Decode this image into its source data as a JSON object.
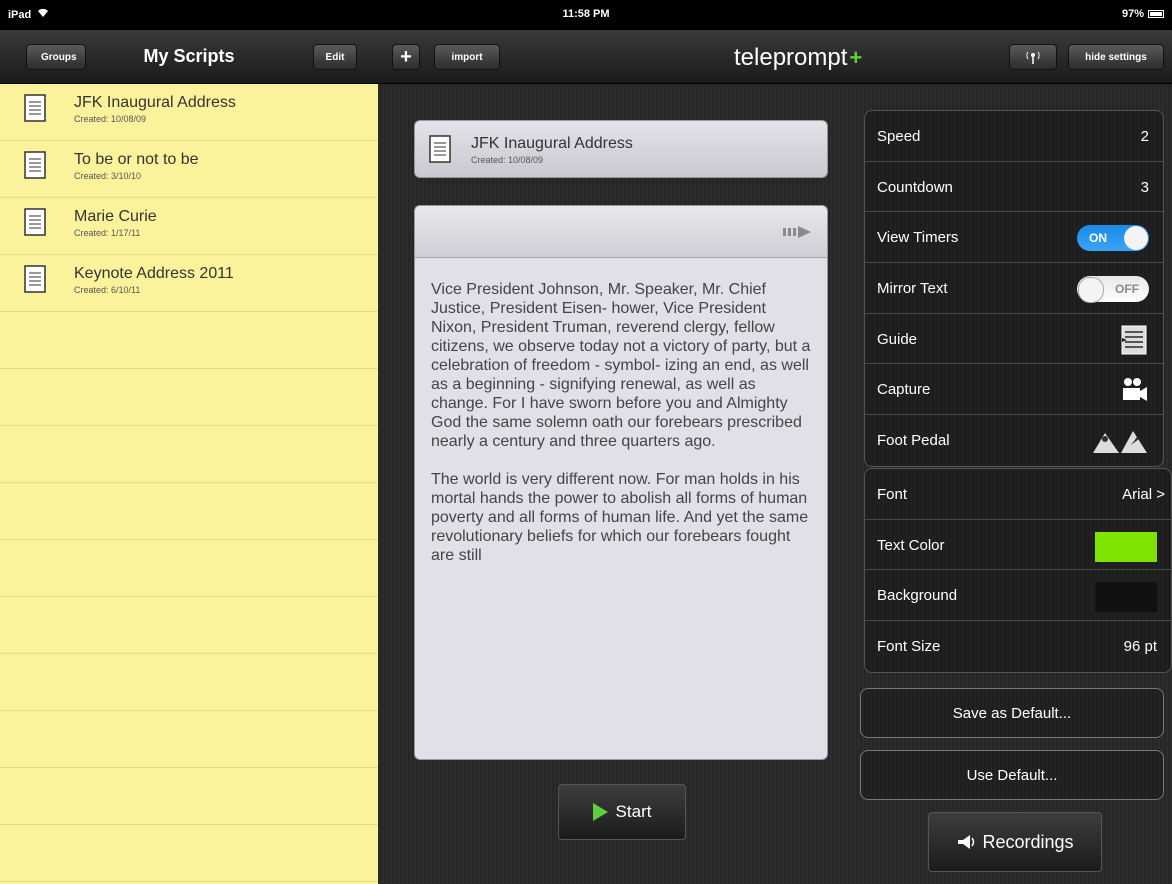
{
  "status_bar": {
    "device": "iPad",
    "time": "11:58 PM",
    "battery": "97%"
  },
  "left_nav": {
    "back_label": "Groups",
    "title": "My Scripts",
    "edit_label": "Edit"
  },
  "scripts": [
    {
      "title": "JFK Inaugural Address",
      "created": "Created: 10/08/09"
    },
    {
      "title": "To be or not to be",
      "created": "Created: 3/10/10"
    },
    {
      "title": "Marie Curie",
      "created": "Created: 1/17/11"
    },
    {
      "title": "Keynote Address 2011",
      "created": "Created: 6/10/11"
    }
  ],
  "toolbar": {
    "import_label": "import",
    "app_title": "teleprompt",
    "app_title_mark": "+",
    "hide_settings_label": "hide settings"
  },
  "current_script": {
    "title": "JFK Inaugural Address",
    "created": "Created: 10/08/09",
    "paragraph1": "Vice President Johnson, Mr. Speaker, Mr. Chief Justice, President Eisen- hower, Vice President Nixon, President Truman, reverend clergy, fellow citizens, we observe today not a victory of party, but a celebration of freedom - symbol- izing an end, as well as a beginning - signifying renewal, as well as change. For I have sworn before you and Almighty God the same solemn oath our forebears prescribed nearly a century and three quarters ago.",
    "paragraph2": "The world is very different now. For man holds in his mortal hands the power to abolish all forms of human poverty and all forms of human life. And yet the same revolutionary beliefs for which our forebears fought are still"
  },
  "start_label": "Start",
  "settings": {
    "speed": {
      "label": "Speed",
      "value": "2"
    },
    "countdown": {
      "label": "Countdown",
      "value": "3"
    },
    "view_timers": {
      "label": "View Timers",
      "state": "ON"
    },
    "mirror_text": {
      "label": "Mirror Text",
      "state": "OFF"
    },
    "guide": {
      "label": "Guide"
    },
    "capture": {
      "label": "Capture"
    },
    "foot_pedal": {
      "label": "Foot Pedal"
    },
    "font": {
      "label": "Font",
      "value": "Arial >"
    },
    "text_color": {
      "label": "Text Color",
      "color": "#7ee300"
    },
    "background": {
      "label": "Background",
      "color": "#111111"
    },
    "font_size": {
      "label": "Font Size",
      "value": "96 pt"
    }
  },
  "save_default_label": "Save as Default...",
  "use_default_label": "Use Default...",
  "recordings_label": "Recordings"
}
